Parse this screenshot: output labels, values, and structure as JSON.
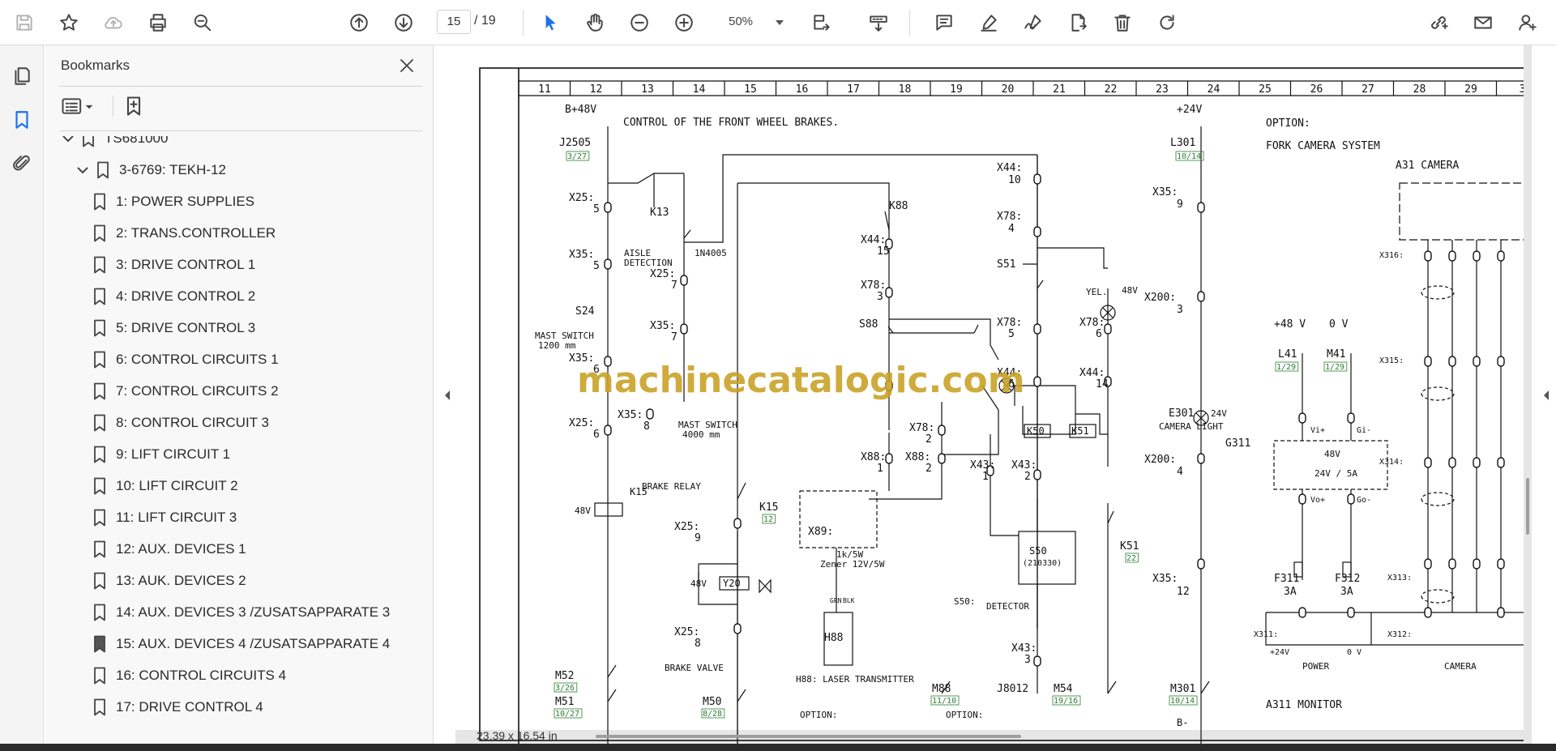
{
  "toolbar": {
    "page_current": "15",
    "page_total": "/ 19",
    "zoom": "50%",
    "icons": [
      "save-icon",
      "star-icon",
      "cloud-upload-icon",
      "print-icon",
      "zoom-search-icon",
      "page-up-icon",
      "page-down-icon",
      "select-pointer-icon",
      "hand-icon",
      "zoom-out-icon",
      "zoom-in-icon",
      "zoom-dropdown",
      "fit-page-icon",
      "marquee-zoom-icon",
      "comment-icon",
      "highlight-icon",
      "sign-icon",
      "edit-export-icon",
      "delete-icon",
      "rotate-icon",
      "share-link-icon",
      "email-icon",
      "add-user-icon"
    ]
  },
  "rail": {
    "icons": [
      "pages-icon",
      "bookmark-icon",
      "attachment-icon"
    ]
  },
  "bookmarks": {
    "title": "Bookmarks",
    "items": [
      {
        "label": "TS681000",
        "level": 0,
        "expanded": true
      },
      {
        "label": "3-6769: TEKH-12",
        "level": 1,
        "expanded": true
      },
      {
        "label": "1: POWER SUPPLIES",
        "level": 2
      },
      {
        "label": "2: TRANS.CONTROLLER",
        "level": 2
      },
      {
        "label": "3: DRIVE CONTROL 1",
        "level": 2
      },
      {
        "label": "4: DRIVE CONTROL 2",
        "level": 2
      },
      {
        "label": "5: DRIVE CONTROL 3",
        "level": 2
      },
      {
        "label": "6: CONTROL CIRCUITS 1",
        "level": 2
      },
      {
        "label": "7: CONTROL CIRCUITS 2",
        "level": 2
      },
      {
        "label": "8: CONTROL CIRCUIT 3",
        "level": 2
      },
      {
        "label": "9: LIFT CIRCUIT 1",
        "level": 2
      },
      {
        "label": "10: LIFT CIRCUIT 2",
        "level": 2
      },
      {
        "label": "11: LIFT CIRCUIT 3",
        "level": 2
      },
      {
        "label": "12: AUX. DEVICES 1",
        "level": 2
      },
      {
        "label": "13: AUK. DEVICES 2",
        "level": 2
      },
      {
        "label": "14: AUX. DEVICES 3 /ZUSATSAPPARATE 3",
        "level": 2
      },
      {
        "label": "15: AUX. DEVICES 4 /ZUSATSAPPARATE 4",
        "level": 2,
        "current": true
      },
      {
        "label": "16: CONTROL CIRCUITS 4",
        "level": 2
      },
      {
        "label": "17: DRIVE CONTROL 4",
        "level": 2
      }
    ]
  },
  "document": {
    "page_size": "23,39 x 16,54 in",
    "watermark": "machinecatalogic.com",
    "columns": [
      "11",
      "12",
      "13",
      "14",
      "15",
      "16",
      "17",
      "18",
      "19",
      "20",
      "21",
      "22",
      "23",
      "24",
      "25",
      "26",
      "27",
      "28",
      "29",
      "3"
    ],
    "labels": {
      "b48": "B+48V",
      "title_brakes": "CONTROL OF THE FRONT WHEEL BRAKES.",
      "v24": "+24V",
      "option": "OPTION:",
      "fork_camera": "FORK CAMERA SYSTEM",
      "a31": "A31 CAMERA",
      "j2505": "J2505",
      "j2505_ref": "3/27",
      "l301": "L301",
      "l301_ref": "10/14",
      "x25_5": "X25:",
      "n5a": "5",
      "k13": "K13",
      "k88": "K88",
      "x44_10": "X44:",
      "n10": "10",
      "x35_9": "X35:",
      "n9": "9",
      "x35_5": "X35:",
      "aisle": "AISLE",
      "detection": "DETECTION",
      "d1n4005": "1N4005",
      "x44_15": "X44:",
      "n15": "15",
      "x78_4": "X78:",
      "n4": "4",
      "s51": "S51",
      "yel": "YEL.",
      "v48": "48V",
      "x25_7": "X25:",
      "n7": "7",
      "x78_3": "X78:",
      "n3": "3",
      "x200_3": "X200:",
      "s24": "S24",
      "mast_switch_1200": "MAST SWITCH",
      "mm1200": "1200 mm",
      "x35_7": "X35:",
      "s88": "S88",
      "x78_5": "X78:",
      "x78_6": "X78:",
      "n6": "6",
      "plus48": "+48 V",
      "zero_v": "0 V",
      "x35_6": "X35:",
      "l41": "L41",
      "l41_ref": "1/29",
      "m41": "M41",
      "m41_ref": "1/29",
      "x44_6": "X44:",
      "x44_14": "X44:",
      "n14": "14",
      "e301": "E301",
      "camera_light": "CAMERA LIGHT",
      "v24b": "24V",
      "x35_8": "X35:",
      "n8": "8",
      "mast_switch_4000": "MAST SWITCH",
      "mm4000": "4000 mm",
      "x78_2": "X78:",
      "n2": "2",
      "k50": "K50",
      "k51": "K51",
      "x25_6": "X25:",
      "g311": "G311",
      "v48g": "48V",
      "v24_5a": "24V / 5A",
      "vi_plus": "Vi+",
      "gi_minus": "Gi-",
      "vo_plus": "Vo+",
      "go_minus": "Go-",
      "x200_4": "X200:",
      "x88_1": "X88:",
      "n1": "1",
      "x88_2": "X88:",
      "x43_1": "X43:",
      "x43_2": "X43:",
      "k15": "K15",
      "k15_ref": "12",
      "brake_relay": "BRAKE RELAY",
      "x25_9": "X25:",
      "x89": "X89:",
      "zener1": "1k/5W",
      "zener2": "Zener 12V/5W",
      "s50": "S50",
      "s50_code": "(210330)",
      "k51b": "K51",
      "k51b_ref": "22",
      "y20": "Y20",
      "s50_detector": "S50:",
      "detector": "DETECTOR",
      "x35_12": "X35:",
      "n12": "12",
      "f311": "F311",
      "f312": "F312",
      "a3": "3A",
      "x313": "X313:",
      "x25_8": "X25:",
      "x311": "X311:",
      "x312": "X312:",
      "plus24v": "+24V",
      "zero_v2": "0 V",
      "power": "POWER",
      "camera": "CAMERA",
      "h88": "H88",
      "grn": "GRN",
      "blk": "BLK",
      "x43_3": "X43:",
      "m52": "M52",
      "m52_ref": "3/26",
      "brake_valve": "BRAKE VALVE",
      "h88_laser": "H88: LASER TRANSMITTER",
      "m88": "M88",
      "m88_ref": "11/10",
      "j8012": "J8012",
      "m54": "M54",
      "m54_ref": "19/16",
      "m301": "M301",
      "m301_ref": "10/14",
      "a311": "A311 MONITOR",
      "m51": "M51",
      "m51_ref": "10/27",
      "m50": "M50",
      "m50_ref": "8/28",
      "option2": "OPTION:",
      "option3": "OPTION:",
      "x316": "X316:",
      "x315": "X315:",
      "x314": "X314:",
      "bminus": "B-"
    }
  }
}
